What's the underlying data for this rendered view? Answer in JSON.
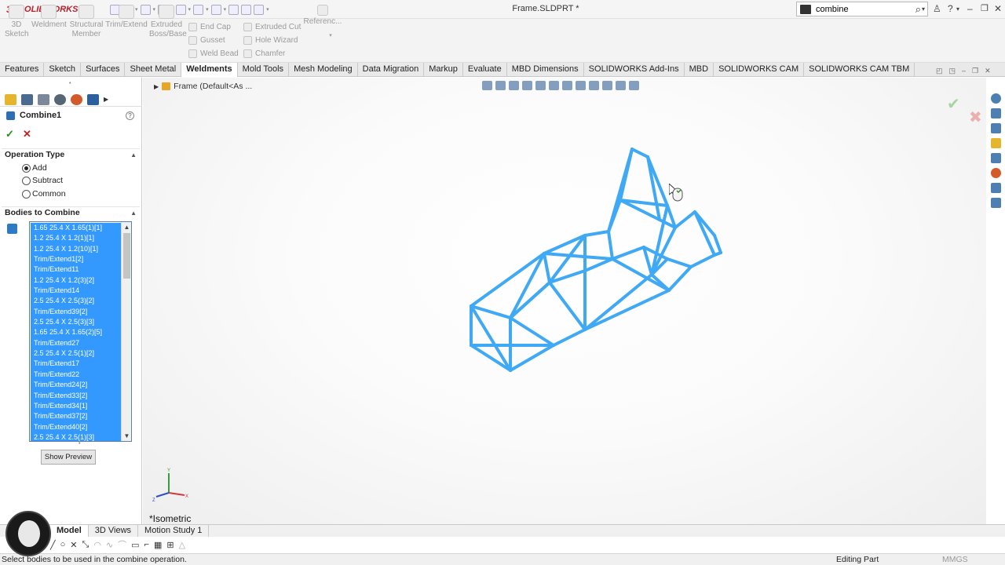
{
  "app": {
    "brand": "SOLIDWORKS",
    "logo_prefix": "3S",
    "document_title": "Frame.SLDPRT *"
  },
  "search": {
    "value": "combine"
  },
  "ribbon": {
    "large_buttons": [
      "3D Sketch",
      "Weldment",
      "Structural Member",
      "Trim/Extend",
      "Extruded Boss/Base"
    ],
    "col1": [
      "End Cap",
      "Gusset",
      "Weld Bead"
    ],
    "col2": [
      "Extruded Cut",
      "Hole Wizard",
      "Chamfer"
    ],
    "reference": "Referenc..."
  },
  "command_tabs": [
    "Features",
    "Sketch",
    "Surfaces",
    "Sheet Metal",
    "Weldments",
    "Mold Tools",
    "Mesh Modeling",
    "Data Migration",
    "Markup",
    "Evaluate",
    "MBD Dimensions",
    "SOLIDWORKS Add-Ins",
    "MBD",
    "SOLIDWORKS CAM",
    "SOLIDWORKS CAM TBM"
  ],
  "active_command_tab": "Weldments",
  "property_manager": {
    "title": "Combine1",
    "operation_type": {
      "label": "Operation Type",
      "options": [
        "Add",
        "Subtract",
        "Common"
      ],
      "selected": "Add"
    },
    "bodies": {
      "label": "Bodies to Combine",
      "items": [
        "1.65 25.4 X 1.65(1)[1]",
        "1.2 25.4 X 1.2(1)[1]",
        "1.2 25.4 X 1.2(10)[1]",
        "Trim/Extend1[2]",
        "Trim/Extend11",
        "1.2 25.4 X 1.2(3)[2]",
        "Trim/Extend14",
        "2.5 25.4 X 2.5(3)[2]",
        "Trim/Extend39[2]",
        "2.5 25.4 X 2.5(3)[3]",
        "1.65 25.4 X 1.65(2)[5]",
        "Trim/Extend27",
        "2.5 25.4 X 2.5(1)[2]",
        "Trim/Extend17",
        "Trim/Extend22",
        "Trim/Extend24[2]",
        "Trim/Extend33[2]",
        "Trim/Extend34[1]",
        "Trim/Extend37[2]",
        "Trim/Extend40[2]",
        "2.5 25.4 X 2.5(1)[3]"
      ]
    },
    "show_preview": "Show Preview"
  },
  "viewport": {
    "tree_label": "Frame  (Default<As ...",
    "view_name": "*Isometric",
    "frame_color": "#3fa9f5"
  },
  "bottom_tabs": [
    "Model",
    "3D Views",
    "Motion Study 1"
  ],
  "active_bottom_tab": "Model",
  "status": {
    "message": "Select bodies to be used in the combine operation.",
    "mode": "Editing Part",
    "units": "MMGS"
  }
}
